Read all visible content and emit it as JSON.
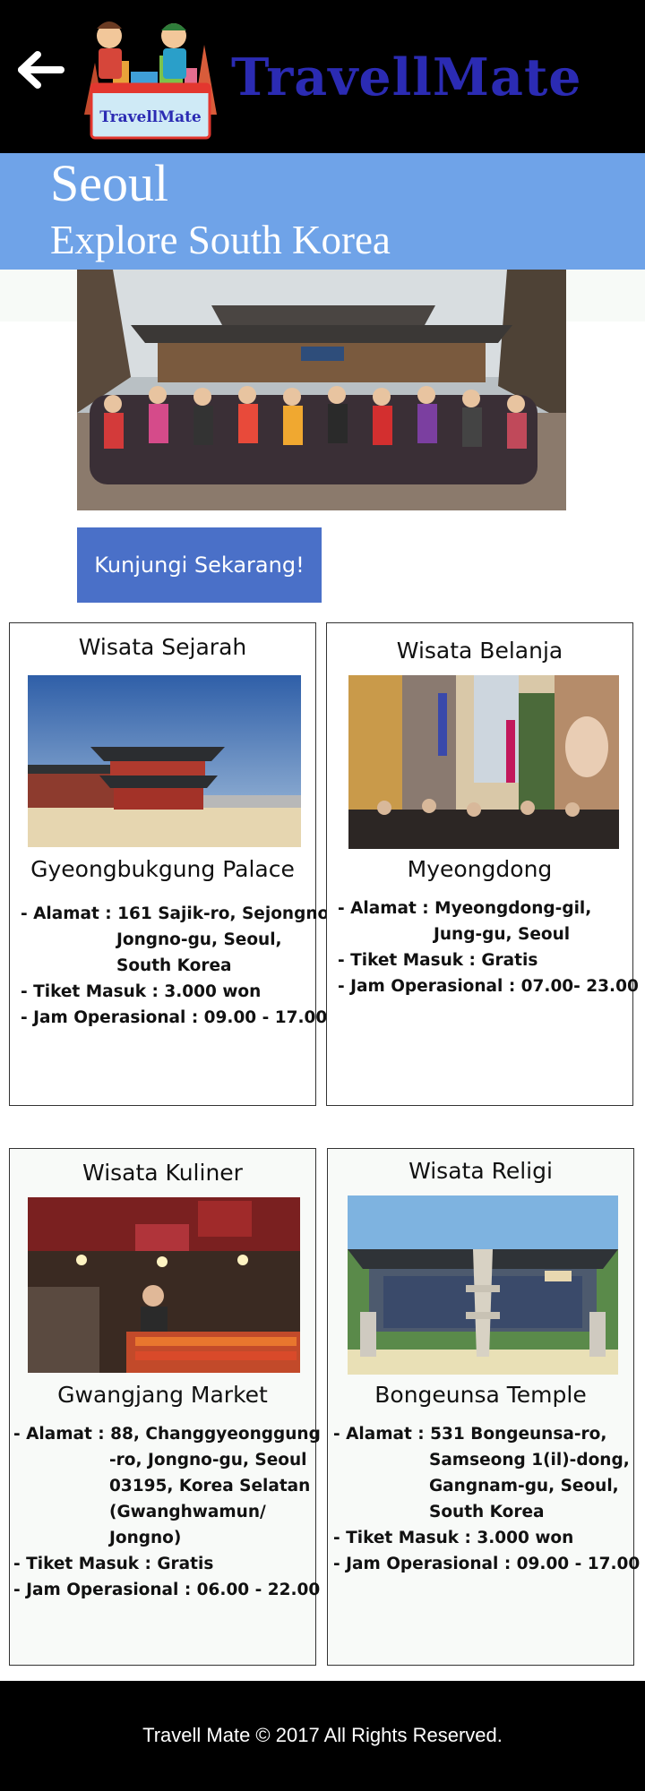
{
  "header": {
    "back_icon": "arrow-left-icon",
    "brand": "TravellMate",
    "logo_badge": "TravellMate"
  },
  "hero": {
    "city": "Seoul",
    "subtitle": "Explore South Korea"
  },
  "cta": {
    "label": "Kunjungi Sekarang!"
  },
  "cards": [
    {
      "category": "Wisata Sejarah",
      "place": "Gyeongbukgung Palace",
      "address_label": "- Alamat : ",
      "address_lines": [
        "161 Sajik-ro, Sejongno,",
        "Jongno-gu, Seoul,",
        "South Korea"
      ],
      "ticket": "- Tiket Masuk : 3.000 won",
      "hours": "- Jam Operasional : 09.00 - 17.00"
    },
    {
      "category": "Wisata Belanja",
      "place": "Myeongdong",
      "address_label": "- Alamat : ",
      "address_lines": [
        "Myeongdong-gil,",
        "Jung-gu, Seoul"
      ],
      "ticket": "- Tiket Masuk : Gratis",
      "hours": "- Jam Operasional : 07.00- 23.00"
    },
    {
      "category": "Wisata Kuliner",
      "place": "Gwangjang Market",
      "address_label": "- Alamat : ",
      "address_lines": [
        "88, Changgyeonggung",
        "-ro, Jongno-gu, Seoul",
        "03195, Korea Selatan",
        "(Gwanghwamun/",
        "Jongno)"
      ],
      "ticket": "- Tiket Masuk : Gratis",
      "hours": "- Jam Operasional : 06.00 - 22.00"
    },
    {
      "category": "Wisata Religi",
      "place": "Bongeunsa Temple",
      "address_label": "- Alamat : ",
      "address_lines": [
        "531 Bongeunsa-ro,",
        "Samseong 1(il)-dong,",
        "Gangnam-gu, Seoul,",
        "South Korea"
      ],
      "ticket": "- Tiket Masuk : 3.000 won",
      "hours": "- Jam Operasional : 09.00 - 17.00"
    }
  ],
  "footer": {
    "text": "Travell Mate © 2017 All Rights Reserved."
  },
  "colors": {
    "header_bg": "#000000",
    "brand": "#2b2bb3",
    "hero_band": "#6fa3e8",
    "cta_bg": "#4a70c8",
    "footer_bg": "#000000"
  }
}
